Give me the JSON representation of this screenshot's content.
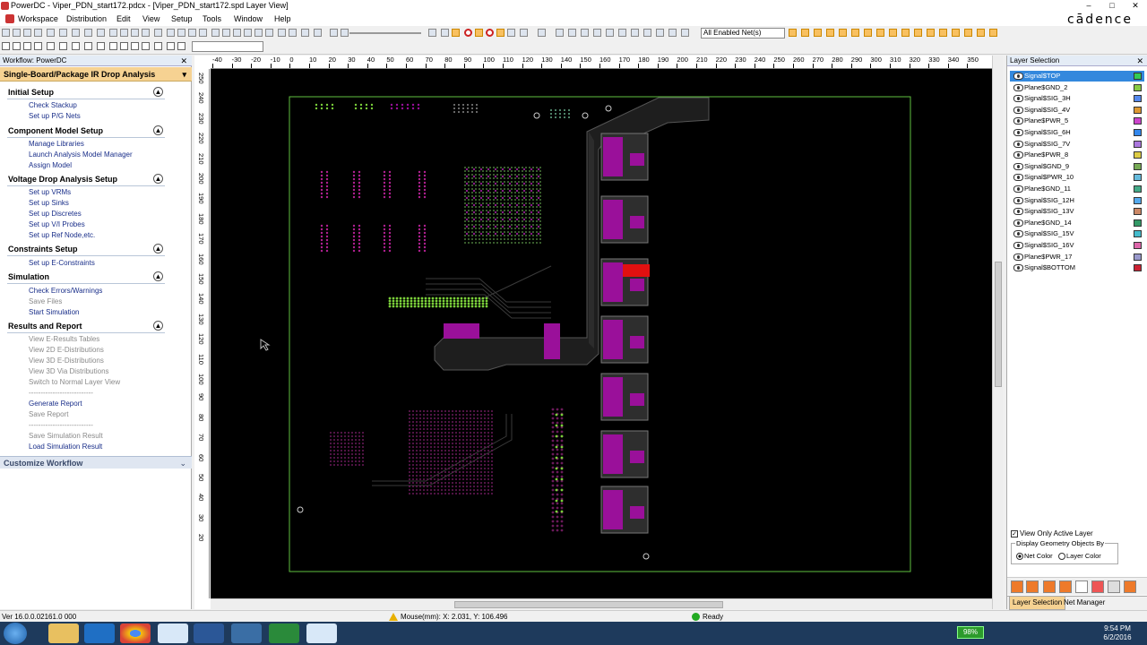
{
  "window": {
    "title": "PowerDC - Viper_PDN_start172.pdcx - [Viper_PDN_start172.spd Layer View]",
    "brand": "cādence",
    "min": "–",
    "max": "□",
    "close": "✕"
  },
  "menu": [
    "Workspace",
    "Distribution",
    "Edit",
    "View",
    "Setup",
    "Tools",
    "Window",
    "Help"
  ],
  "toolbar": {
    "net_filter": "All Enabled Net(s)"
  },
  "workflow": {
    "header": "Workflow: PowerDC",
    "title": "Single-Board/Package IR Drop Analysis",
    "sections": [
      {
        "label": "Initial Setup",
        "items": [
          {
            "label": "Check Stackup"
          },
          {
            "label": "Set up P/G Nets"
          }
        ]
      },
      {
        "label": "Component Model Setup",
        "items": [
          {
            "label": "Manage Libraries"
          },
          {
            "label": "Launch Analysis Model Manager"
          },
          {
            "label": "Assign Model"
          }
        ]
      },
      {
        "label": "Voltage Drop Analysis Setup",
        "items": [
          {
            "label": "Set up VRMs"
          },
          {
            "label": "Set up Sinks"
          },
          {
            "label": "Set up Discretes"
          },
          {
            "label": "Set up V/I Probes"
          },
          {
            "label": "Set up Ref Node,etc."
          }
        ]
      },
      {
        "label": "Constraints Setup",
        "items": [
          {
            "label": "Set up E-Constraints"
          }
        ]
      },
      {
        "label": "Simulation",
        "items": [
          {
            "label": "Check Errors/Warnings"
          },
          {
            "label": "Save Files"
          },
          {
            "label": "Start Simulation"
          }
        ]
      },
      {
        "label": "Results and Report",
        "items": [
          {
            "label": "View E-Results Tables"
          },
          {
            "label": "View 2D E-Distributions"
          },
          {
            "label": "View 3D E-Distributions"
          },
          {
            "label": "View 3D Via Distributions"
          },
          {
            "label": "Switch to Normal Layer View"
          },
          {
            "label": "---------------------------"
          },
          {
            "label": "Generate Report"
          },
          {
            "label": "Save Report"
          },
          {
            "label": "---------------------------"
          },
          {
            "label": "Save Simulation Result"
          },
          {
            "label": "Load Simulation Result"
          }
        ]
      }
    ],
    "customize": "Customize Workflow"
  },
  "ruler": {
    "top": [
      "-40",
      "-30",
      "-20",
      "-10",
      "0",
      "10",
      "20",
      "30",
      "40",
      "50",
      "60",
      "70",
      "80",
      "90",
      "100",
      "110",
      "120",
      "130",
      "140",
      "150",
      "160",
      "170",
      "180",
      "190",
      "200",
      "210",
      "220",
      "230",
      "240",
      "250",
      "260",
      "270",
      "280",
      "290",
      "300",
      "310",
      "320",
      "330",
      "340",
      "350"
    ],
    "left": [
      "250",
      "240",
      "230",
      "220",
      "210",
      "200",
      "190",
      "180",
      "170",
      "160",
      "150",
      "140",
      "130",
      "120",
      "110",
      "100",
      "90",
      "80",
      "70",
      "60",
      "50",
      "40",
      "30",
      "20"
    ]
  },
  "layers": {
    "header": "Layer Selection",
    "items": [
      {
        "name": "Signal$TOP",
        "color": "#33cc55",
        "selected": true
      },
      {
        "name": "Plane$GND_2",
        "color": "#88cc44"
      },
      {
        "name": "Signal$SIG_3H",
        "color": "#5588ee"
      },
      {
        "name": "Signal$SIG_4V",
        "color": "#dd9933"
      },
      {
        "name": "Plane$PWR_5",
        "color": "#cc44cc"
      },
      {
        "name": "Signal$SIG_6H",
        "color": "#3388ee"
      },
      {
        "name": "Signal$SIG_7V",
        "color": "#aa77dd"
      },
      {
        "name": "Plane$PWR_8",
        "color": "#ddcc44"
      },
      {
        "name": "Signal$GND_9",
        "color": "#77aa55"
      },
      {
        "name": "Signal$PWR_10",
        "color": "#66bbdd"
      },
      {
        "name": "Plane$GND_11",
        "color": "#44aa88"
      },
      {
        "name": "Signal$SIG_12H",
        "color": "#55aaee"
      },
      {
        "name": "Signal$SIG_13V",
        "color": "#cc8866"
      },
      {
        "name": "Plane$GND_14",
        "color": "#339966"
      },
      {
        "name": "Signal$SIG_15V",
        "color": "#44bbcc"
      },
      {
        "name": "Signal$SIG_16V",
        "color": "#dd66aa"
      },
      {
        "name": "Plane$PWR_17",
        "color": "#9999cc"
      },
      {
        "name": "Signal$BOTTOM",
        "color": "#cc2233"
      }
    ],
    "view_only_active": "View Only Active Layer",
    "display_group": "Display Geometry Objects By",
    "net_color": "Net Color",
    "layer_color": "Layer Color",
    "tabs": [
      "Layer Selection",
      "Net Manager"
    ]
  },
  "status": {
    "version": "Ver 16.0.0.02161.0   000",
    "mouse": "Mouse(mm): X: 2.031, Y: 106.496",
    "state": "Ready"
  },
  "taskbar": {
    "battery": "98%",
    "time": "9:54 PM",
    "date": "6/2/2016"
  }
}
